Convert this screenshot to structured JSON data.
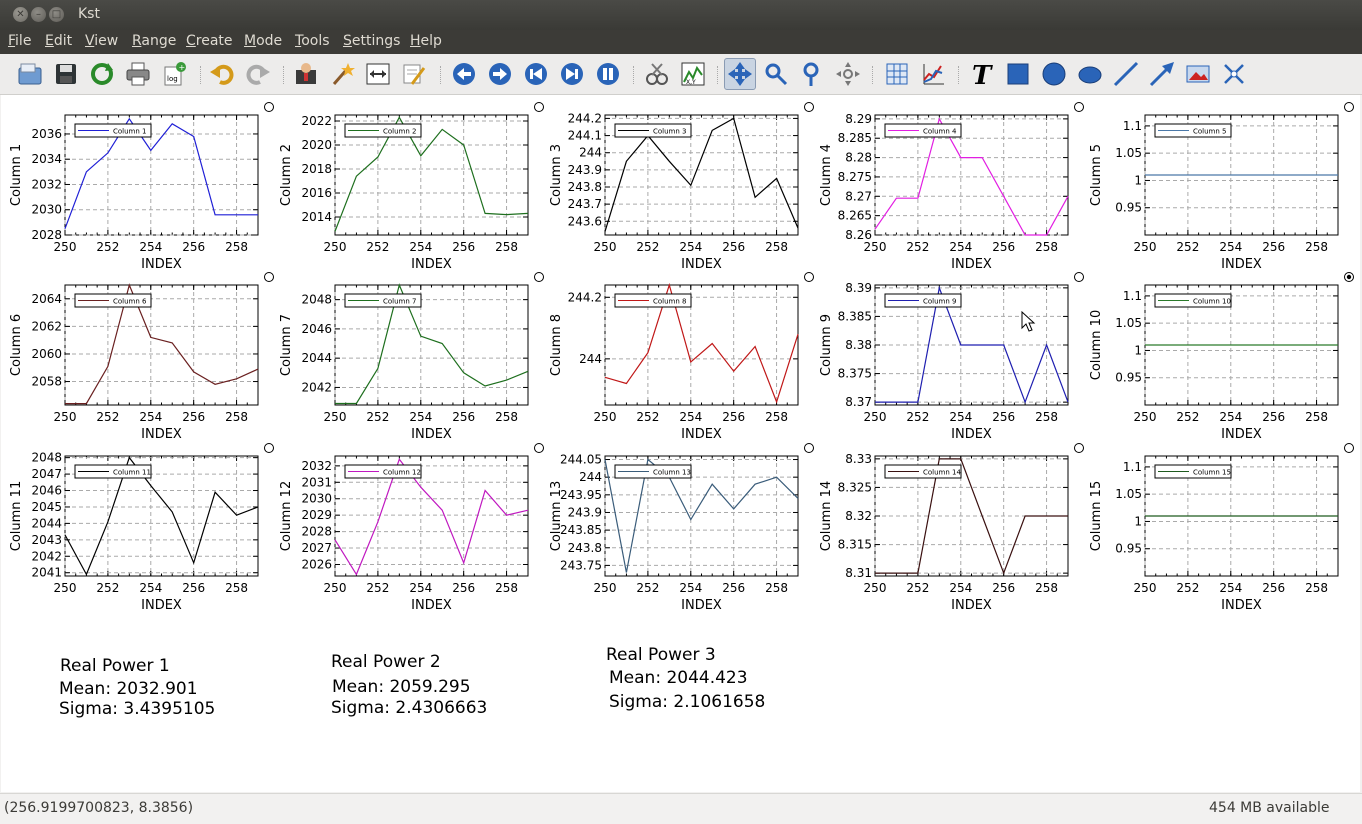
{
  "window": {
    "title": "Kst"
  },
  "menu": [
    "File",
    "Edit",
    "View",
    "Range",
    "Create",
    "Mode",
    "Tools",
    "Settings",
    "Help"
  ],
  "toolbar": [
    "open-icon",
    "save-icon",
    "reload-icon",
    "print-icon",
    "export-log-icon",
    "undo-icon",
    "redo-icon",
    "data-manager-icon",
    "data-wizard-icon",
    "change-file-icon",
    "edit-text-icon",
    "zoom-back-icon",
    "zoom-forward-icon",
    "back-icon",
    "forward-icon",
    "pause-icon",
    "edit-vector-icon",
    "xy-icon",
    "layout-icon",
    "zoom-x-icon",
    "zoom-y-icon",
    "zoom-tied-icon",
    "grid-icon",
    "plot-icon",
    "text-icon",
    "box-icon",
    "circle-icon",
    "ellipse-icon",
    "line-icon",
    "arrow-icon",
    "picture-icon",
    "cross-icon"
  ],
  "colors": {
    "c1": "#1f1fd6",
    "c2": "#1e6f1e",
    "c3": "#000000",
    "c4": "#e21ee2",
    "c5": "#4a78a8",
    "c6": "#6a2020",
    "c7": "#1e6f1e",
    "c8": "#c01818",
    "c9": "#1f1fb0",
    "c10": "#2a7a2a",
    "c11": "#000000",
    "c12": "#c018c0",
    "c13": "#3a5c7a",
    "c14": "#3a1010",
    "c15": "#1e5a1e"
  },
  "chart_data": [
    {
      "type": "line",
      "title": "",
      "xlabel": "INDEX",
      "ylabel": "Column 1",
      "legend": "Column 1",
      "xlim": [
        250,
        259
      ],
      "ylim": [
        2028,
        2037.5
      ],
      "x": [
        250,
        251,
        252,
        253,
        254,
        255,
        256,
        257,
        258,
        259
      ],
      "y": [
        2028.5,
        2033,
        2034.5,
        2037.2,
        2034.7,
        2036.8,
        2035.8,
        2029.6,
        2029.6,
        2029.6
      ],
      "yticks": [
        2028,
        2030,
        2032,
        2034,
        2036
      ],
      "color": "c1"
    },
    {
      "type": "line",
      "xlabel": "INDEX",
      "ylabel": "Column 2",
      "legend": "Column 2",
      "xlim": [
        250,
        259
      ],
      "ylim": [
        2012.5,
        2022.5
      ],
      "x": [
        250,
        251,
        252,
        253,
        254,
        255,
        256,
        257,
        258,
        259
      ],
      "y": [
        2012.8,
        2017.4,
        2019,
        2022.3,
        2019.1,
        2021.3,
        2020,
        2014.3,
        2014.2,
        2014.3
      ],
      "yticks": [
        2014,
        2016,
        2018,
        2020,
        2022
      ],
      "color": "c2"
    },
    {
      "type": "line",
      "xlabel": "INDEX",
      "ylabel": "Column 3",
      "legend": "Column 3",
      "xlim": [
        250,
        259
      ],
      "ylim": [
        243.52,
        244.22
      ],
      "x": [
        250,
        251,
        252,
        253,
        254,
        255,
        256,
        257,
        258,
        259
      ],
      "y": [
        243.54,
        243.95,
        244.1,
        243.95,
        243.81,
        244.13,
        244.2,
        243.74,
        243.85,
        243.56
      ],
      "yticks": [
        243.6,
        243.7,
        243.8,
        243.9,
        244,
        244.1,
        244.2
      ],
      "ytl": [
        "243.6",
        "243.7",
        "243.8",
        "243.9",
        "244",
        "244.1",
        "244.2"
      ],
      "color": "c3"
    },
    {
      "type": "line",
      "xlabel": "INDEX",
      "ylabel": "Column 4",
      "legend": "Column 4",
      "xlim": [
        250,
        259
      ],
      "ylim": [
        8.26,
        8.291
      ],
      "x": [
        250,
        251,
        252,
        253,
        254,
        255,
        256,
        257,
        258,
        259
      ],
      "y": [
        8.2615,
        8.2695,
        8.2695,
        8.29,
        8.28,
        8.28,
        8.27,
        8.26,
        8.26,
        8.27
      ],
      "yticks": [
        8.26,
        8.265,
        8.27,
        8.275,
        8.28,
        8.285,
        8.29
      ],
      "ytl": [
        "8.26",
        "8.265",
        "8.27",
        "8.275",
        "8.28",
        "8.285",
        "8.29"
      ],
      "color": "c4"
    },
    {
      "type": "line",
      "xlabel": "INDEX",
      "ylabel": "Column 5",
      "legend": "Column 5",
      "xlim": [
        250,
        259
      ],
      "ylim": [
        0.9,
        1.12
      ],
      "x": [
        250,
        259
      ],
      "y": [
        1.01,
        1.01
      ],
      "yticks": [
        0.95,
        1,
        1.05,
        1.1
      ],
      "ytl": [
        "0.95",
        "1",
        "1.05",
        "1.1"
      ],
      "color": "c5"
    },
    {
      "type": "line",
      "xlabel": "INDEX",
      "ylabel": "Column 6",
      "legend": "Column 6",
      "xlim": [
        250,
        259
      ],
      "ylim": [
        2056.3,
        2065
      ],
      "x": [
        250,
        251,
        252,
        253,
        254,
        255,
        256,
        257,
        258,
        259
      ],
      "y": [
        2056.4,
        2056.4,
        2059.1,
        2065,
        2061.2,
        2060.8,
        2058.7,
        2057.8,
        2058.2,
        2058.9
      ],
      "yticks": [
        2058,
        2060,
        2062,
        2064
      ],
      "color": "c6"
    },
    {
      "type": "line",
      "xlabel": "INDEX",
      "ylabel": "Column 7",
      "legend": "Column 7",
      "xlim": [
        250,
        259
      ],
      "ylim": [
        2040.8,
        2049
      ],
      "x": [
        250,
        251,
        252,
        253,
        254,
        255,
        256,
        257,
        258,
        259
      ],
      "y": [
        2040.9,
        2040.9,
        2043.3,
        2049,
        2045.5,
        2045,
        2043,
        2042.1,
        2042.5,
        2043.1
      ],
      "yticks": [
        2042,
        2044,
        2046,
        2048
      ],
      "color": "c7"
    },
    {
      "type": "line",
      "xlabel": "INDEX",
      "ylabel": "Column 8",
      "legend": "Column 8",
      "xlim": [
        250,
        259
      ],
      "ylim": [
        243.85,
        244.24
      ],
      "x": [
        250,
        251,
        252,
        253,
        254,
        255,
        256,
        257,
        258,
        259
      ],
      "y": [
        243.94,
        243.92,
        244.02,
        244.24,
        243.99,
        244.05,
        243.96,
        244.04,
        243.86,
        244.08
      ],
      "yticks": [
        244,
        244.2
      ],
      "ytl": [
        "244",
        "244.2"
      ],
      "color": "c8"
    },
    {
      "type": "line",
      "xlabel": "INDEX",
      "ylabel": "Column 9",
      "legend": "Column 9",
      "xlim": [
        250,
        259
      ],
      "ylim": [
        8.3695,
        8.3905
      ],
      "x": [
        250,
        251,
        252,
        253,
        254,
        255,
        256,
        257,
        258,
        259
      ],
      "y": [
        8.37,
        8.37,
        8.37,
        8.39,
        8.38,
        8.38,
        8.38,
        8.37,
        8.38,
        8.37
      ],
      "yticks": [
        8.37,
        8.375,
        8.38,
        8.385,
        8.39
      ],
      "ytl": [
        "8.37",
        "8.375",
        "8.38",
        "8.385",
        "8.39"
      ],
      "color": "c9"
    },
    {
      "type": "line",
      "xlabel": "INDEX",
      "ylabel": "Column 10",
      "legend": "Column 10",
      "xlim": [
        250,
        259
      ],
      "ylim": [
        0.9,
        1.12
      ],
      "x": [
        250,
        259
      ],
      "y": [
        1.01,
        1.01
      ],
      "yticks": [
        0.95,
        1,
        1.05,
        1.1
      ],
      "ytl": [
        "0.95",
        "1",
        "1.05",
        "1.1"
      ],
      "color": "c10"
    },
    {
      "type": "line",
      "xlabel": "INDEX",
      "ylabel": "Column 11",
      "legend": "Column 11",
      "xlim": [
        250,
        259
      ],
      "ylim": [
        2040.8,
        2048.1
      ],
      "x": [
        250,
        251,
        252,
        253,
        254,
        255,
        256,
        257,
        258,
        259
      ],
      "y": [
        2043.3,
        2040.9,
        2044.1,
        2048,
        2046.3,
        2044.7,
        2041.6,
        2045.9,
        2044.5,
        2045
      ],
      "yticks": [
        2041,
        2042,
        2043,
        2044,
        2045,
        2046,
        2047,
        2048
      ],
      "color": "c11"
    },
    {
      "type": "line",
      "xlabel": "INDEX",
      "ylabel": "Column 12",
      "legend": "Column 12",
      "xlim": [
        250,
        259
      ],
      "ylim": [
        2025.3,
        2032.6
      ],
      "x": [
        250,
        251,
        252,
        253,
        254,
        255,
        256,
        257,
        258,
        259
      ],
      "y": [
        2027.5,
        2025.4,
        2028.6,
        2032.4,
        2030.7,
        2029.3,
        2026.1,
        2030.5,
        2029,
        2029.3
      ],
      "yticks": [
        2026,
        2027,
        2028,
        2029,
        2030,
        2031,
        2032
      ],
      "color": "c12"
    },
    {
      "type": "line",
      "xlabel": "INDEX",
      "ylabel": "Column 13",
      "legend": "Column 13",
      "xlim": [
        250,
        259
      ],
      "ylim": [
        243.72,
        244.06
      ],
      "x": [
        250,
        251,
        252,
        253,
        254,
        255,
        256,
        257,
        258,
        259
      ],
      "y": [
        244.05,
        243.73,
        244.05,
        244,
        243.88,
        243.98,
        243.91,
        243.98,
        244,
        243.94
      ],
      "yticks": [
        243.75,
        243.8,
        243.85,
        243.9,
        243.95,
        244,
        244.05
      ],
      "ytl": [
        "243.75",
        "243.8",
        "243.85",
        "243.9",
        "243.95",
        "244",
        "244.05"
      ],
      "color": "c13"
    },
    {
      "type": "line",
      "xlabel": "INDEX",
      "ylabel": "Column 14",
      "legend": "Column 14",
      "xlim": [
        250,
        259
      ],
      "ylim": [
        8.3095,
        8.3305
      ],
      "x": [
        250,
        251,
        252,
        253,
        254,
        255,
        256,
        257,
        258,
        259
      ],
      "y": [
        8.31,
        8.31,
        8.31,
        8.33,
        8.33,
        8.32,
        8.31,
        8.32,
        8.32,
        8.32
      ],
      "yticks": [
        8.31,
        8.315,
        8.32,
        8.325,
        8.33
      ],
      "ytl": [
        "8.31",
        "8.315",
        "8.32",
        "8.325",
        "8.33"
      ],
      "color": "c14"
    },
    {
      "type": "line",
      "xlabel": "INDEX",
      "ylabel": "Column 15",
      "legend": "Column 15",
      "xlim": [
        250,
        259
      ],
      "ylim": [
        0.9,
        1.12
      ],
      "x": [
        250,
        259
      ],
      "y": [
        1.01,
        1.01
      ],
      "yticks": [
        0.95,
        1,
        1.05,
        1.1
      ],
      "ytl": [
        "0.95",
        "1",
        "1.05",
        "1.1"
      ],
      "color": "c15"
    }
  ],
  "xticks": [
    "250",
    "252",
    "254",
    "256",
    "258"
  ],
  "selected_plot": 9,
  "stats": [
    {
      "title": "Real Power 1",
      "mean": "Mean: 2032.901",
      "sigma": "Sigma: 3.4395105"
    },
    {
      "title": "Real Power 2",
      "mean": "Mean: 2059.295",
      "sigma": "Sigma: 2.4306663"
    },
    {
      "title": "Real Power 3",
      "mean": "Mean: 2044.423",
      "sigma": "Sigma: 2.1061658"
    }
  ],
  "status": {
    "coords": "(256.9199700823, 8.3856)",
    "memory": "454 MB available"
  }
}
